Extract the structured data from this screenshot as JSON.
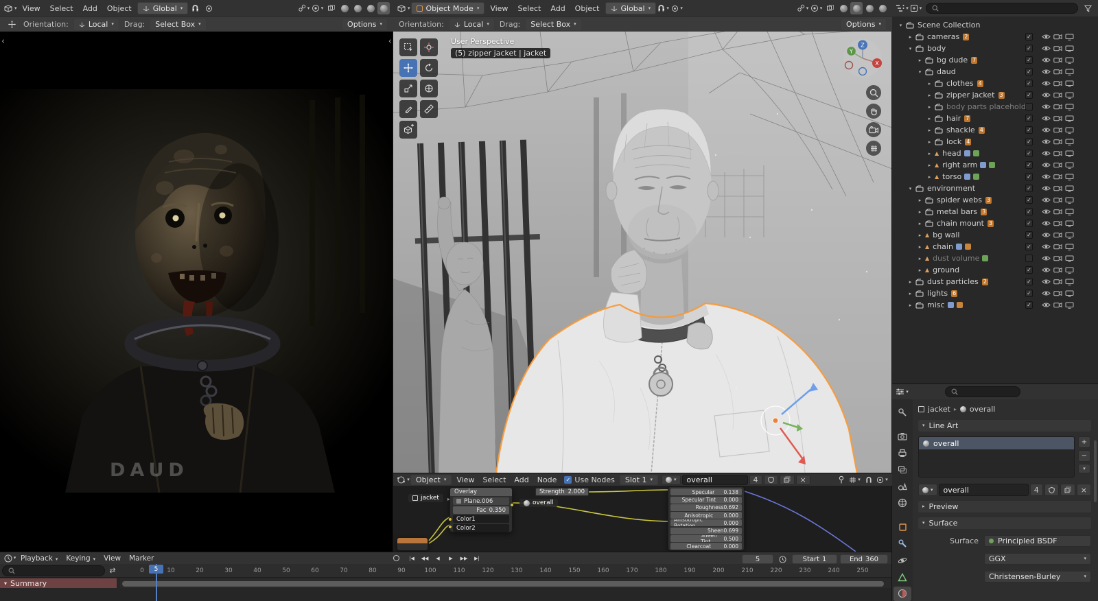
{
  "colors": {
    "accent_blue": "#4772b3",
    "selection_orange": "#f79a3a",
    "badge_orange": "#c0762b",
    "summary_red": "#6e4242"
  },
  "left_viewport": {
    "menus": [
      "View",
      "Select",
      "Add",
      "Object"
    ],
    "orientation": "Global",
    "tool_settings": {
      "orientation_label": "Orientation:",
      "orientation_value": "Local",
      "drag_label": "Drag:",
      "drag_value": "Select Box",
      "options_label": "Options"
    },
    "watermark": "DAUD"
  },
  "center_viewport": {
    "mode": "Object Mode",
    "menus": [
      "View",
      "Select",
      "Add",
      "Object"
    ],
    "orientation": "Global",
    "tool_settings": {
      "orientation_label": "Orientation:",
      "orientation_value": "Local",
      "drag_label": "Drag:",
      "drag_value": "Select Box",
      "options_label": "Options"
    },
    "overlay_line1": "User Perspective",
    "overlay_line2": "(5) zipper jacket | jacket",
    "axis": {
      "x": "X",
      "y": "Y",
      "z": "Z"
    }
  },
  "shader_editor": {
    "mode": "Object",
    "menus": [
      "View",
      "Select",
      "Add",
      "Node"
    ],
    "use_nodes_label": "Use Nodes",
    "slot_label": "Slot 1",
    "material_name": "overall",
    "material_users": "4",
    "breadcrumb_object": "jacket",
    "mix_node": {
      "title": "Overlay",
      "source": "Plane.006",
      "fac_label": "Fac",
      "fac_value": "0.350",
      "fac_fill": "width:35%",
      "input1": "Color1",
      "input2": "Color2"
    },
    "strength_label": "Strength",
    "strength_value": "2.000",
    "material_node_label": "overall",
    "bsdf_rows": [
      {
        "label": "Specular",
        "value": "0.138",
        "fill": "width:14%"
      },
      {
        "label": "Specular Tint",
        "value": "0.000",
        "fill": "width:0%"
      },
      {
        "label": "Roughness",
        "value": "0.692",
        "fill": "width:69%"
      },
      {
        "label": "Anisotropic",
        "value": "0.000",
        "fill": "width:0%"
      },
      {
        "label": "Anisotropic Rotation",
        "value": "0.000",
        "fill": "width:0%"
      },
      {
        "label": "Sheen",
        "value": "0.699",
        "fill": "width:70%"
      },
      {
        "label": "Sheen Tint",
        "value": "0.500",
        "fill": "width:50%"
      },
      {
        "label": "Clearcoat",
        "value": "0.000",
        "fill": "width:0%"
      }
    ]
  },
  "outliner": {
    "rows": [
      {
        "label": "Scene Collection",
        "arrow": "▾",
        "pad": "width:2px",
        "is_col": true,
        "no_toggles": true
      },
      {
        "label": "cameras",
        "arrow": "▸",
        "pad": "width:16px",
        "is_col": true,
        "count": "2",
        "checked": true
      },
      {
        "label": "body",
        "arrow": "▾",
        "pad": "width:16px",
        "is_col": true,
        "checked": true
      },
      {
        "label": "bg dude",
        "arrow": "▸",
        "pad": "width:30px",
        "is_col": true,
        "count": "7",
        "checked": true
      },
      {
        "label": "daud",
        "arrow": "▾",
        "pad": "width:30px",
        "is_col": true,
        "checked": true
      },
      {
        "label": "clothes",
        "arrow": "▸",
        "pad": "width:44px",
        "is_col": true,
        "count": "4",
        "checked": true
      },
      {
        "label": "zipper jacket",
        "arrow": "▸",
        "pad": "width:44px",
        "is_col": true,
        "count": "3",
        "checked": true
      },
      {
        "label": "body parts placeholde",
        "arrow": "▸",
        "pad": "width:44px",
        "is_col": true,
        "muted": true,
        "checked": false
      },
      {
        "label": "hair",
        "arrow": "▸",
        "pad": "width:44px",
        "is_col": true,
        "count": "7",
        "checked": true
      },
      {
        "label": "shackle",
        "arrow": "▸",
        "pad": "width:44px",
        "is_col": true,
        "count": "4",
        "checked": true
      },
      {
        "label": "lock",
        "arrow": "▸",
        "pad": "width:44px",
        "is_col": true,
        "count": "4",
        "checked": true
      },
      {
        "label": "head",
        "arrow": "▸",
        "pad": "width:44px",
        "is_mesh": true,
        "x1": "background:#8aa8e0",
        "x2": "background:#74b05c",
        "checked": true
      },
      {
        "label": "right arm",
        "arrow": "▸",
        "pad": "width:44px",
        "is_mesh": true,
        "x1": "background:#8aa8e0",
        "x2": "background:#74b05c",
        "checked": true
      },
      {
        "label": "torso",
        "arrow": "▸",
        "pad": "width:44px",
        "is_mesh": true,
        "x1": "background:#8aa8e0",
        "x2": "background:#74b05c",
        "checked": true
      },
      {
        "label": "environment",
        "arrow": "▾",
        "pad": "width:16px",
        "is_col": true,
        "checked": true
      },
      {
        "label": "spider webs",
        "arrow": "▸",
        "pad": "width:30px",
        "is_col": true,
        "count": "3",
        "checked": true
      },
      {
        "label": "metal bars",
        "arrow": "▸",
        "pad": "width:30px",
        "is_col": true,
        "count": "3",
        "checked": true
      },
      {
        "label": "chain mount",
        "arrow": "▸",
        "pad": "width:30px",
        "is_col": true,
        "count": "3",
        "checked": true
      },
      {
        "label": "bg wall",
        "arrow": "▸",
        "pad": "width:30px",
        "is_mesh": true,
        "checked": true
      },
      {
        "label": "chain",
        "arrow": "▸",
        "pad": "width:30px",
        "is_mesh": true,
        "x1": "background:#8aa8e0",
        "x2": "background:#d98e3c",
        "checked": true
      },
      {
        "label": "dust volume",
        "arrow": "▸",
        "pad": "width:30px",
        "is_mesh": true,
        "muted": true,
        "checked": false,
        "x1": "background:#74b05c"
      },
      {
        "label": "ground",
        "arrow": "▸",
        "pad": "width:30px",
        "is_mesh": true,
        "checked": true
      },
      {
        "label": "dust particles",
        "arrow": "▸",
        "pad": "width:16px",
        "is_col": true,
        "count": "2",
        "checked": true
      },
      {
        "label": "lights",
        "arrow": "▸",
        "pad": "width:16px",
        "is_col": true,
        "count": "6",
        "checked": true
      },
      {
        "label": "misc",
        "arrow": "▸",
        "pad": "width:16px",
        "is_col": true,
        "x1": "background:#8aa8e0",
        "x2": "background:#d98e3c",
        "checked": true
      }
    ]
  },
  "properties": {
    "breadcrumb_object": "jacket",
    "breadcrumb_material": "overall",
    "line_art_label": "Line Art",
    "slot_name": "overall",
    "material_name": "overall",
    "material_users": "4",
    "preview_label": "Preview",
    "surface_section_label": "Surface",
    "surface_label": "Surface",
    "surface_value": "Principled BSDF",
    "distribution_value": "GGX",
    "subsurface_value": "Christensen-Burley"
  },
  "timeline": {
    "menus": [
      {
        "label": "Playback",
        "caret": true
      },
      {
        "label": "Keying",
        "caret": true
      },
      {
        "label": "View"
      },
      {
        "label": "Marker"
      }
    ],
    "transport": [
      "|◀",
      "◀◀",
      "◀",
      "▶",
      "▶▶",
      "▶|"
    ],
    "frame_value": "5",
    "start_label": "Start",
    "start_value": "1",
    "end_label": "End",
    "end_value": "360",
    "playhead_label": "5",
    "summary_label": "Summary",
    "ticks": [
      {
        "label": "0",
        "style": "left:32px"
      },
      {
        "label": "10",
        "style": "left:74px"
      },
      {
        "label": "20",
        "style": "left:116px"
      },
      {
        "label": "30",
        "style": "left:158px"
      },
      {
        "label": "40",
        "style": "left:200px"
      },
      {
        "label": "50",
        "style": "left:242px"
      },
      {
        "label": "60",
        "style": "left:284px"
      },
      {
        "label": "70",
        "style": "left:326px"
      },
      {
        "label": "80",
        "style": "left:368px"
      },
      {
        "label": "90",
        "style": "left:410px"
      },
      {
        "label": "100",
        "style": "left:452px"
      },
      {
        "label": "110",
        "style": "left:494px"
      },
      {
        "label": "120",
        "style": "left:536px"
      },
      {
        "label": "130",
        "style": "left:578px"
      },
      {
        "label": "140",
        "style": "left:620px"
      },
      {
        "label": "150",
        "style": "left:662px"
      },
      {
        "label": "160",
        "style": "left:704px"
      },
      {
        "label": "170",
        "style": "left:746px"
      },
      {
        "label": "180",
        "style": "left:788px"
      },
      {
        "label": "190",
        "style": "left:830px"
      },
      {
        "label": "200",
        "style": "left:872px"
      },
      {
        "label": "210",
        "style": "left:914px"
      },
      {
        "label": "220",
        "style": "left:956px"
      },
      {
        "label": "230",
        "style": "left:998px"
      },
      {
        "label": "240",
        "style": "left:1040px"
      },
      {
        "label": "250",
        "style": "left:1082px"
      }
    ]
  }
}
